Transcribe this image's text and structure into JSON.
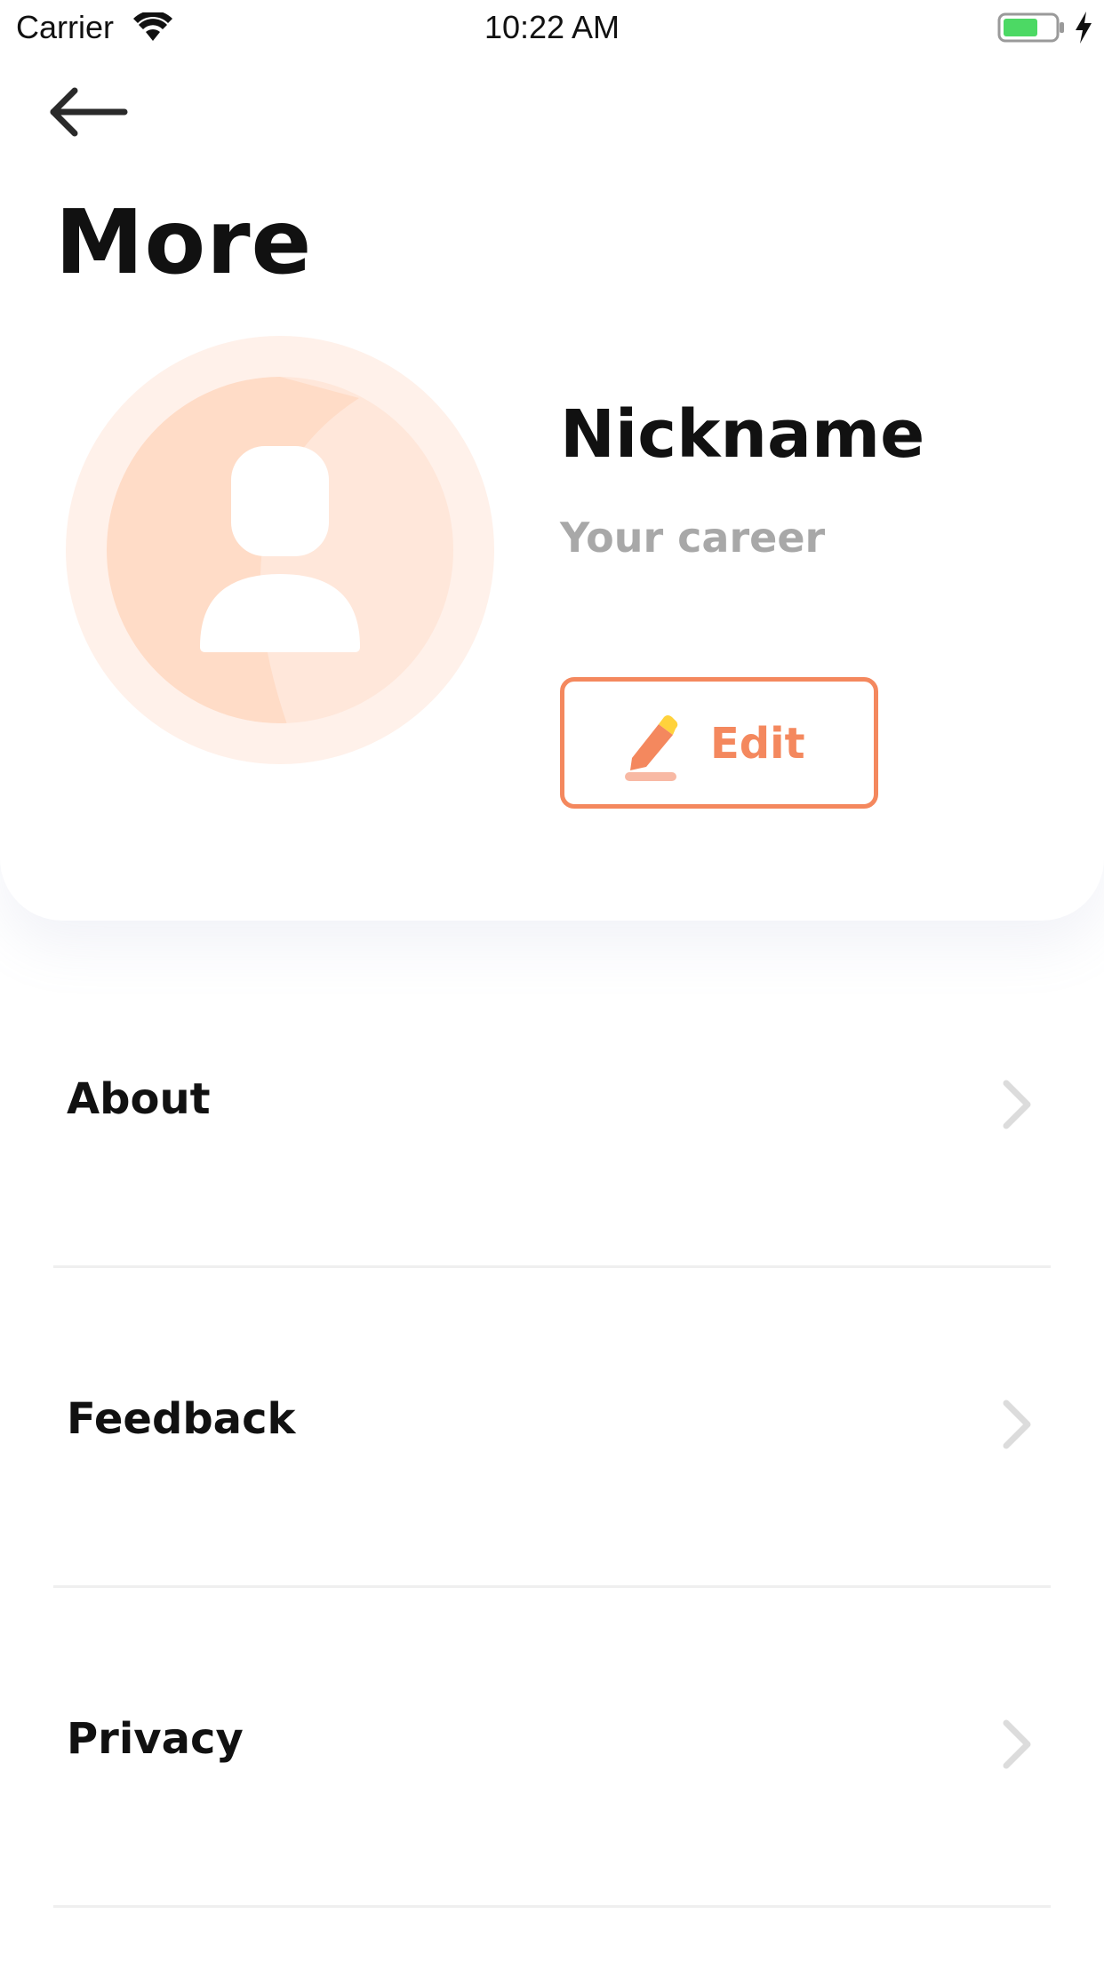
{
  "status_bar": {
    "carrier": "Carrier",
    "time": "10:22 AM",
    "battery_color": "#4cd964"
  },
  "header": {
    "title": "More",
    "back_icon": "arrow-left-icon"
  },
  "profile": {
    "nickname": "Nickname",
    "career": "Your career",
    "avatar_icon": "user-placeholder-icon",
    "edit_label": "Edit",
    "edit_icon": "pencil-icon",
    "accent_color": "#f4885e"
  },
  "menu": {
    "items": [
      {
        "label": "About",
        "icon": "chevron-right-icon"
      },
      {
        "label": "Feedback",
        "icon": "chevron-right-icon"
      },
      {
        "label": "Privacy",
        "icon": "chevron-right-icon"
      }
    ]
  }
}
